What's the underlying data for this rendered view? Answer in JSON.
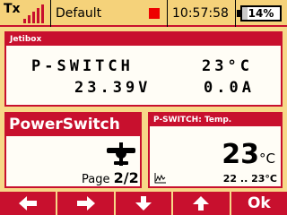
{
  "status_bar": {
    "tx_label": "Tx",
    "model_name": "Default",
    "time": "10:57:58",
    "battery_percent": "14%",
    "battery_level": 0.14
  },
  "jetibox": {
    "title": "Jetibox",
    "line1_left": "P-SWITCH",
    "line1_right": "23°C",
    "line2_left": "23.39V",
    "line2_right": "0.0A"
  },
  "power_switch": {
    "title": "PowerSwitch",
    "page_label": "Page",
    "page_value": "2/2"
  },
  "temperature": {
    "title": "P-SWITCH: Temp.",
    "value": "23",
    "unit": "°C",
    "range": "22 .. 23°C"
  },
  "buttons": {
    "left": "left-arrow-icon",
    "right": "right-arrow-icon",
    "down": "down-arrow-icon",
    "up": "up-arrow-icon",
    "ok_label": "Ok"
  },
  "colors": {
    "accent": "#c8102e",
    "background": "#f7d888"
  }
}
